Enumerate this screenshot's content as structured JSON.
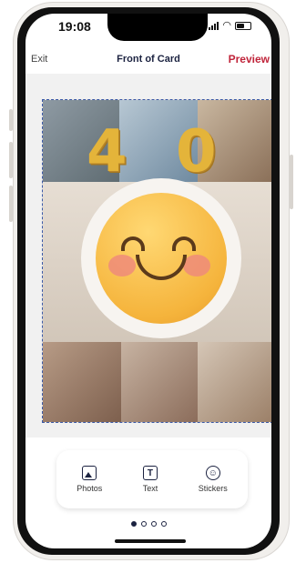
{
  "status_bar": {
    "time": "19:08"
  },
  "nav": {
    "exit_label": "Exit",
    "title": "Front of Card",
    "preview_label": "Preview"
  },
  "card": {
    "balloon_numbers": [
      "4",
      "0"
    ],
    "center_image": "smiling-emoji"
  },
  "toolbar": {
    "items": [
      {
        "label": "Photos",
        "icon": "photo-icon"
      },
      {
        "label": "Text",
        "icon": "text-icon"
      },
      {
        "label": "Stickers",
        "icon": "sticker-icon"
      }
    ]
  },
  "pager": {
    "total_pages": 4,
    "current_page": 1
  },
  "colors": {
    "accent": "#c0243a",
    "primary": "#1b2240",
    "balloon_gold": "#e4b43a",
    "selection_border": "#3b5aa8"
  }
}
